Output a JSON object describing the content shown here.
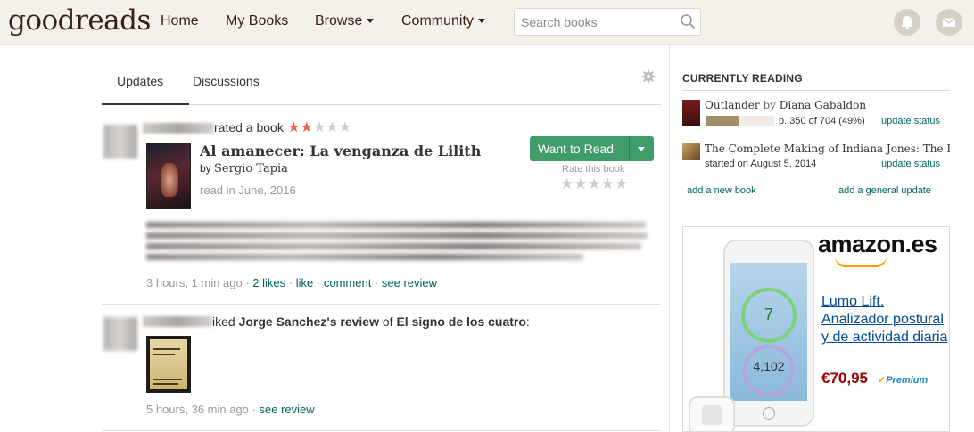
{
  "header": {
    "logo_good": "good",
    "logo_reads": "reads",
    "nav": {
      "home": "Home",
      "my_books": "My Books",
      "browse": "Browse",
      "community": "Community"
    },
    "search_placeholder": "Search books"
  },
  "tabs": {
    "updates": "Updates",
    "discussions": "Discussions"
  },
  "update1": {
    "action": "rated a book",
    "rating": 2,
    "max_rating": 5,
    "book_title": "Al amanecer: La venganza de Lilith",
    "by": "by",
    "author": "Sergio Tapia",
    "read_date": "read in June, 2016",
    "want_to_read": "Want to Read",
    "rate_this_book": "Rate this book",
    "time": "3 hours, 1 min ago",
    "dot": "·",
    "likes": "2 likes",
    "like": "like",
    "comment": "comment",
    "see_review": "see review"
  },
  "update2": {
    "action": "iked",
    "reviewer": "Jorge Sanchez's review",
    "of": "of",
    "book_title": "El signo de los cuatro",
    "colon": ":",
    "time": "5 hours, 36 min ago",
    "dot": "·",
    "see_review": "see review"
  },
  "sidebar": {
    "title": "CURRENTLY READING",
    "book1": {
      "title": "Outlander",
      "by": "by",
      "author": "Diana Gabaldon",
      "progress_pct": 49,
      "progress_text": "p. 350 of 704 (49%)",
      "update_status": "update status"
    },
    "book2": {
      "title": "The Complete Making of Indiana Jones: The Defi",
      "started": "started on August 5, 2014",
      "update_status": "update status"
    },
    "add_new_book": "add a new book",
    "add_general_update": "add a general update"
  },
  "ad": {
    "logo": "amazon.es",
    "phone_num1": "7",
    "phone_num2": "4,102",
    "product": "Lumo Lift. Analizador postural y de actividad diaria",
    "price": "€70,95",
    "prime_check": "✓",
    "prime": "Premium"
  },
  "colors": {
    "header_bg": "#f4f1ea",
    "brand": "#382110",
    "button_green": "#409d69",
    "link": "#00635d",
    "star_on": "#e76350"
  }
}
